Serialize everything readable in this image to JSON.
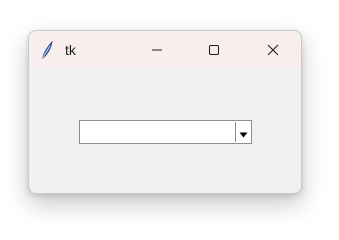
{
  "window": {
    "title": "tk",
    "app_icon": "tk-feather-icon",
    "controls": {
      "minimize": "minimize-icon",
      "maximize": "maximize-icon",
      "close": "close-icon"
    }
  },
  "combobox": {
    "value": "",
    "dropdown_icon": "chevron-down-icon"
  },
  "colors": {
    "titlebar_bg": "#f9eeee",
    "window_bg": "#f0f0f0",
    "combobox_bg": "#ffffff",
    "border": "#8f8f8f"
  }
}
